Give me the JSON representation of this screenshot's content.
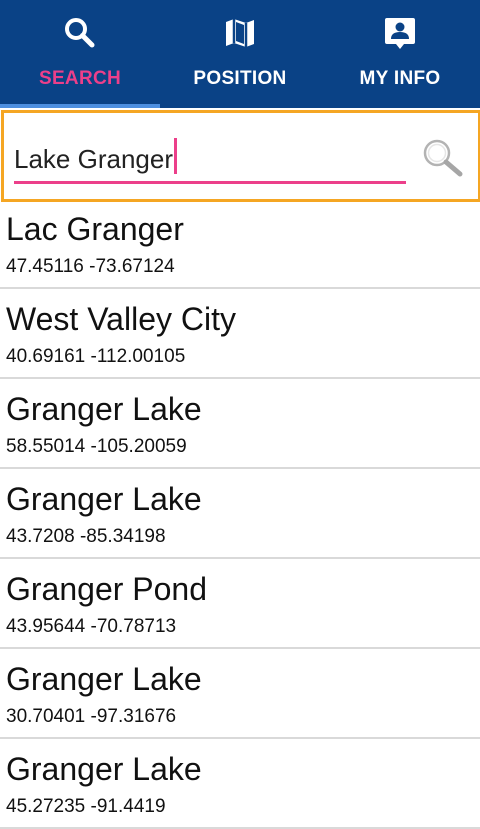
{
  "tabs": [
    {
      "label": "SEARCH",
      "icon": "search-icon",
      "active": true
    },
    {
      "label": "POSITION",
      "icon": "map-icon",
      "active": false
    },
    {
      "label": "MY INFO",
      "icon": "contact-card-icon",
      "active": false
    }
  ],
  "colors": {
    "toolbar": "#0a4286",
    "active_tab_text": "#ec3f8a",
    "tab_indicator": "#4d8fe0",
    "search_focus_border": "#f5a623",
    "input_underline": "#ec3f8a",
    "divider": "#d9d9d9"
  },
  "search": {
    "value": "Lake Granger",
    "button_icon": "magnifier-icon"
  },
  "results": [
    {
      "name": "Lac Granger",
      "coords": "47.45116 -73.67124"
    },
    {
      "name": "West Valley City",
      "coords": "40.69161 -112.00105"
    },
    {
      "name": "Granger Lake",
      "coords": "58.55014 -105.20059"
    },
    {
      "name": "Granger Lake",
      "coords": "43.7208 -85.34198"
    },
    {
      "name": "Granger Pond",
      "coords": "43.95644 -70.78713"
    },
    {
      "name": "Granger Lake",
      "coords": "30.70401 -97.31676"
    },
    {
      "name": "Granger Lake",
      "coords": "45.27235 -91.4419"
    }
  ]
}
